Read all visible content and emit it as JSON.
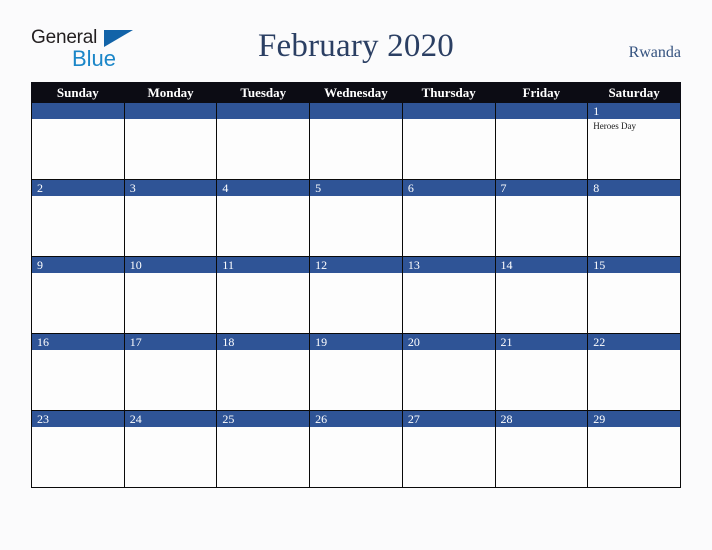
{
  "brand": {
    "name_part1": "General",
    "name_part2": "Blue",
    "triangle_icon": "triangle-icon"
  },
  "header": {
    "title": "February 2020",
    "country": "Rwanda"
  },
  "colors": {
    "header_row_bg": "#0c0c14",
    "date_bar_bg": "#2f5496",
    "title_text": "#2b3f63",
    "country_text": "#34527f",
    "brand_dark": "#231f20",
    "brand_blue": "#1b86c8",
    "triangle_blue": "#1263a8",
    "page_bg": "#fbfbfc",
    "cell_bg": "#fdfdfd",
    "grid_line": "#0a0a0a"
  },
  "calendar": {
    "weekday_headers": [
      "Sunday",
      "Monday",
      "Tuesday",
      "Wednesday",
      "Thursday",
      "Friday",
      "Saturday"
    ],
    "weeks": [
      [
        {
          "day": "",
          "events": []
        },
        {
          "day": "",
          "events": []
        },
        {
          "day": "",
          "events": []
        },
        {
          "day": "",
          "events": []
        },
        {
          "day": "",
          "events": []
        },
        {
          "day": "",
          "events": []
        },
        {
          "day": "1",
          "events": [
            "Heroes Day"
          ]
        }
      ],
      [
        {
          "day": "2",
          "events": []
        },
        {
          "day": "3",
          "events": []
        },
        {
          "day": "4",
          "events": []
        },
        {
          "day": "5",
          "events": []
        },
        {
          "day": "6",
          "events": []
        },
        {
          "day": "7",
          "events": []
        },
        {
          "day": "8",
          "events": []
        }
      ],
      [
        {
          "day": "9",
          "events": []
        },
        {
          "day": "10",
          "events": []
        },
        {
          "day": "11",
          "events": []
        },
        {
          "day": "12",
          "events": []
        },
        {
          "day": "13",
          "events": []
        },
        {
          "day": "14",
          "events": []
        },
        {
          "day": "15",
          "events": []
        }
      ],
      [
        {
          "day": "16",
          "events": []
        },
        {
          "day": "17",
          "events": []
        },
        {
          "day": "18",
          "events": []
        },
        {
          "day": "19",
          "events": []
        },
        {
          "day": "20",
          "events": []
        },
        {
          "day": "21",
          "events": []
        },
        {
          "day": "22",
          "events": []
        }
      ],
      [
        {
          "day": "23",
          "events": []
        },
        {
          "day": "24",
          "events": []
        },
        {
          "day": "25",
          "events": []
        },
        {
          "day": "26",
          "events": []
        },
        {
          "day": "27",
          "events": []
        },
        {
          "day": "28",
          "events": []
        },
        {
          "day": "29",
          "events": []
        }
      ]
    ]
  }
}
